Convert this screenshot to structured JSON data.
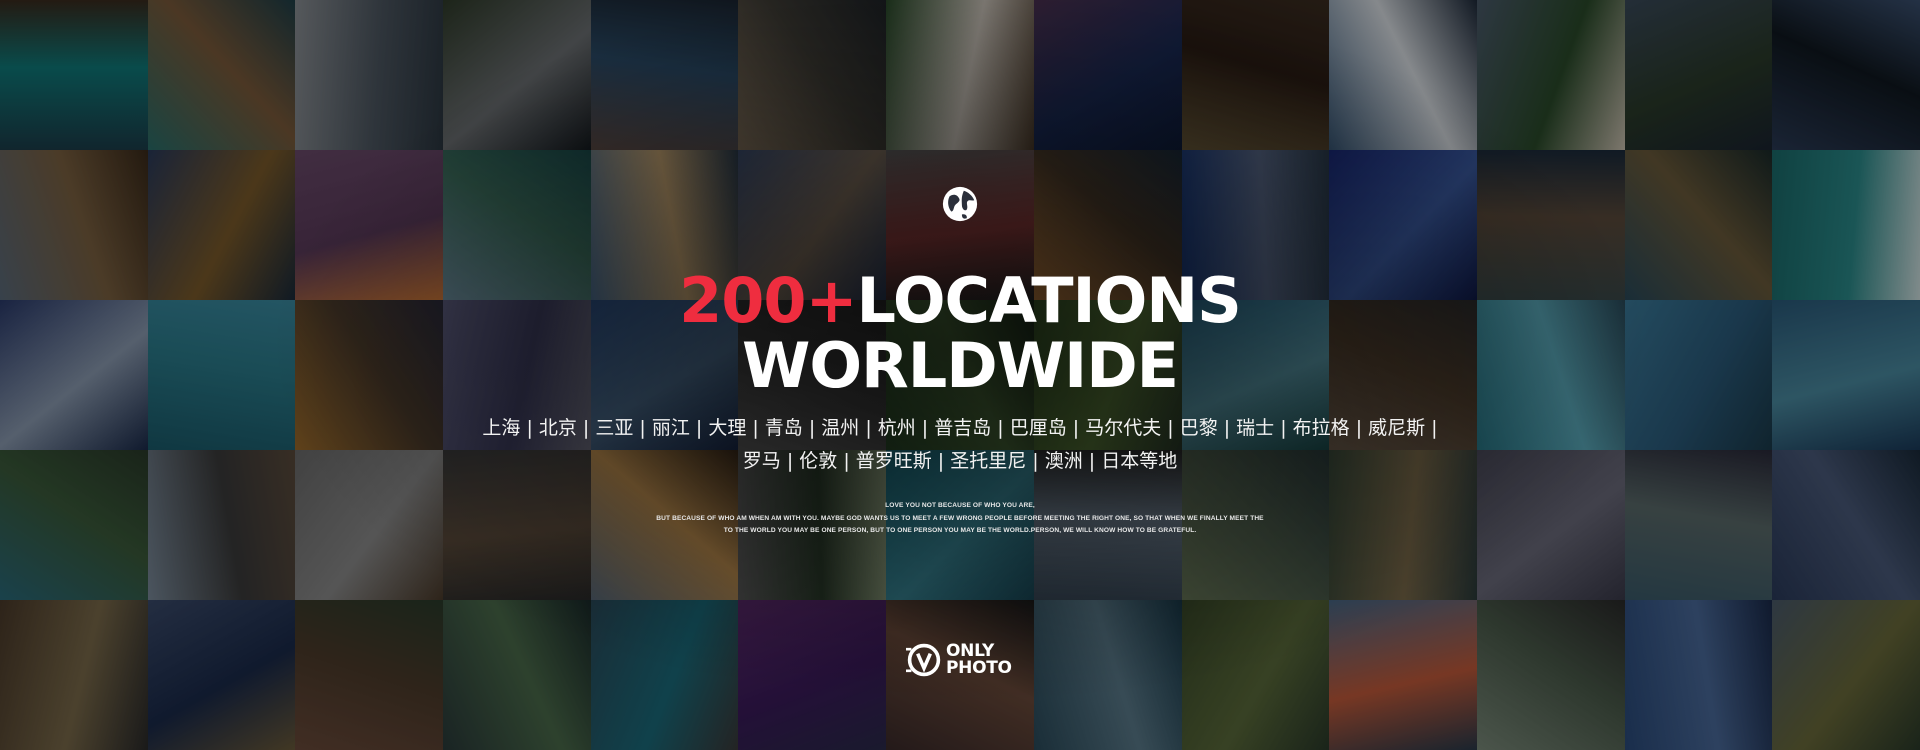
{
  "hero": {
    "headline_accent": "200+",
    "headline_line1": "LOCATIONS",
    "headline_line2": "WORLDWIDE",
    "cities_line1": "上海 | 北京 | 三亚 | 丽江 | 大理 | 青岛 | 温州 | 杭州 | 普吉岛 | 巴厘岛 | 马尔代夫 | 巴黎 | 瑞士 | 布拉格 | 威尼斯 |",
    "cities_line2": "罗马 | 伦敦 | 普罗旺斯 | 圣托里尼 | 澳洲 | 日本等地",
    "quote_line1": "LOVE YOU NOT BECAUSE OF WHO YOU ARE,",
    "quote_line2": "BUT BECAUSE OF WHO AM WHEN AM WITH YOU. MAYBE GOD WANTS US TO MEET A FEW WRONG PEOPLE BEFORE MEETING THE RIGHT ONE, SO THAT WHEN WE FINALLY MEET THE",
    "quote_line3": "TO THE WORLD YOU MAY BE ONE PERSON, BUT TO ONE PERSON YOU MAY BE THE WORLD.PERSON, WE WILL KNOW HOW TO BE GRATEFUL."
  },
  "logo": {
    "icon": "vonly-logo-icon",
    "line1": "ONLY",
    "line2": "PHOTO"
  },
  "decor": {
    "globe_icon": "globe-icon",
    "accent_color": "#ef2d3f"
  }
}
